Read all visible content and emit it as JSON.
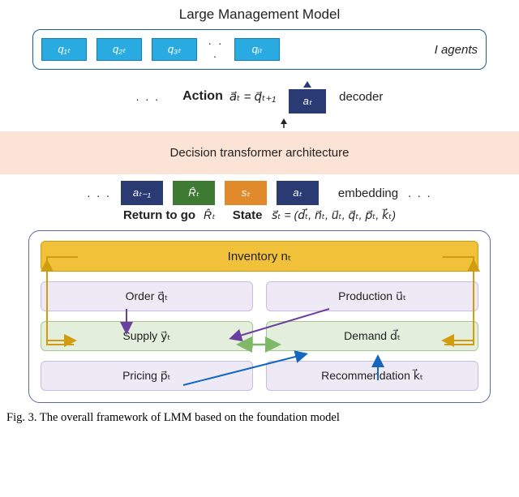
{
  "title": "Large Management Model",
  "agents": {
    "label": "I agents",
    "boxes": [
      "q₁ₜ",
      "q₂ₜ",
      "q₃ₜ",
      "qᵢₜ"
    ],
    "ellipsis": "· · ·"
  },
  "action": {
    "prefix_ellipsis": ". . .",
    "label": "Action",
    "equation": "a⃗ₜ = q⃗ₜ₊₁",
    "box": "aₜ",
    "decoder_label": "decoder"
  },
  "transformer": {
    "label": "Decision transformer architecture"
  },
  "embedding": {
    "prefix_ellipsis": ". . .",
    "boxes": [
      {
        "text": "aₜ₋₁",
        "color": "c-navy"
      },
      {
        "text": "R̂ₜ",
        "color": "c-green"
      },
      {
        "text": "sₜ",
        "color": "c-orange"
      },
      {
        "text": "aₜ",
        "color": "c-navy"
      }
    ],
    "label": "embedding",
    "suffix_ellipsis": ". . ."
  },
  "state_row": {
    "rtg_label": "Return to go",
    "rtg_symbol": "R̂ₜ",
    "state_label": "State",
    "state_equation": "s⃗ₜ = (d⃗ₜ, n⃗ₜ, u⃗ₜ, q⃗ₜ, p⃗ₜ, k⃗ₜ)"
  },
  "environment": {
    "inventory": "Inventory nₜ",
    "order": "Order q⃗ₜ",
    "production": "Production u⃗ₜ",
    "supply": "Supply y⃗ₜ",
    "demand": "Demand d⃗ₜ",
    "pricing": "Pricing p⃗ₜ",
    "recommendation": "Recommendation k⃗ₜ"
  },
  "caption": "Fig. 3.   The overall framework of LMM based on the foundation model"
}
